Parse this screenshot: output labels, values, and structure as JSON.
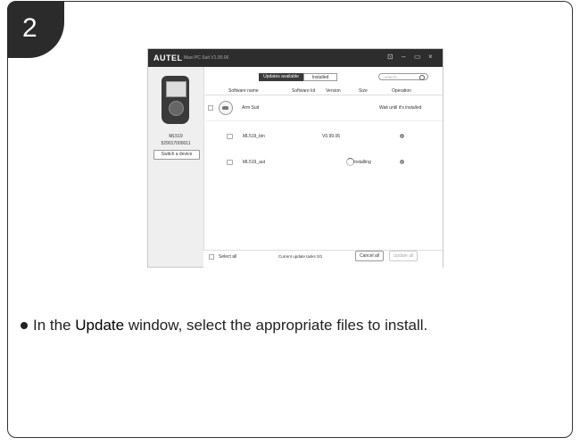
{
  "step": {
    "number": "2"
  },
  "app": {
    "logo": "AUTEL",
    "title": "Maxi PC Suit V1.00.06",
    "window_controls": {
      "screen": "⊡",
      "minimize": "–",
      "maximize": "▭",
      "close": "×"
    }
  },
  "device": {
    "model": "ML519",
    "serial": "529017000011",
    "switch_label": "Switch a device"
  },
  "tabs": [
    {
      "label": "Updates available",
      "active": true
    },
    {
      "label": "Installed",
      "active": false
    }
  ],
  "search": {
    "placeholder": "search..."
  },
  "table": {
    "headers": [
      "Software name",
      "Software kit",
      "Version",
      "Size",
      "Operation"
    ],
    "group": {
      "name": "Arm Suit",
      "status": "Wait until it's installed"
    },
    "rows": [
      {
        "name": "ML519_bin",
        "version": "V0.99.06",
        "operation": ""
      },
      {
        "name": "ML519_aut",
        "version": "",
        "operation": "Installing"
      }
    ]
  },
  "footer": {
    "select_all": "Select all",
    "tasks": "Current update tasks 0/1",
    "cancel_all": "Cancel all",
    "update_all": "Update all"
  },
  "instruction": {
    "prefix": "In the ",
    "keyword": "Update",
    "suffix": " window, select the appropriate files to install."
  }
}
